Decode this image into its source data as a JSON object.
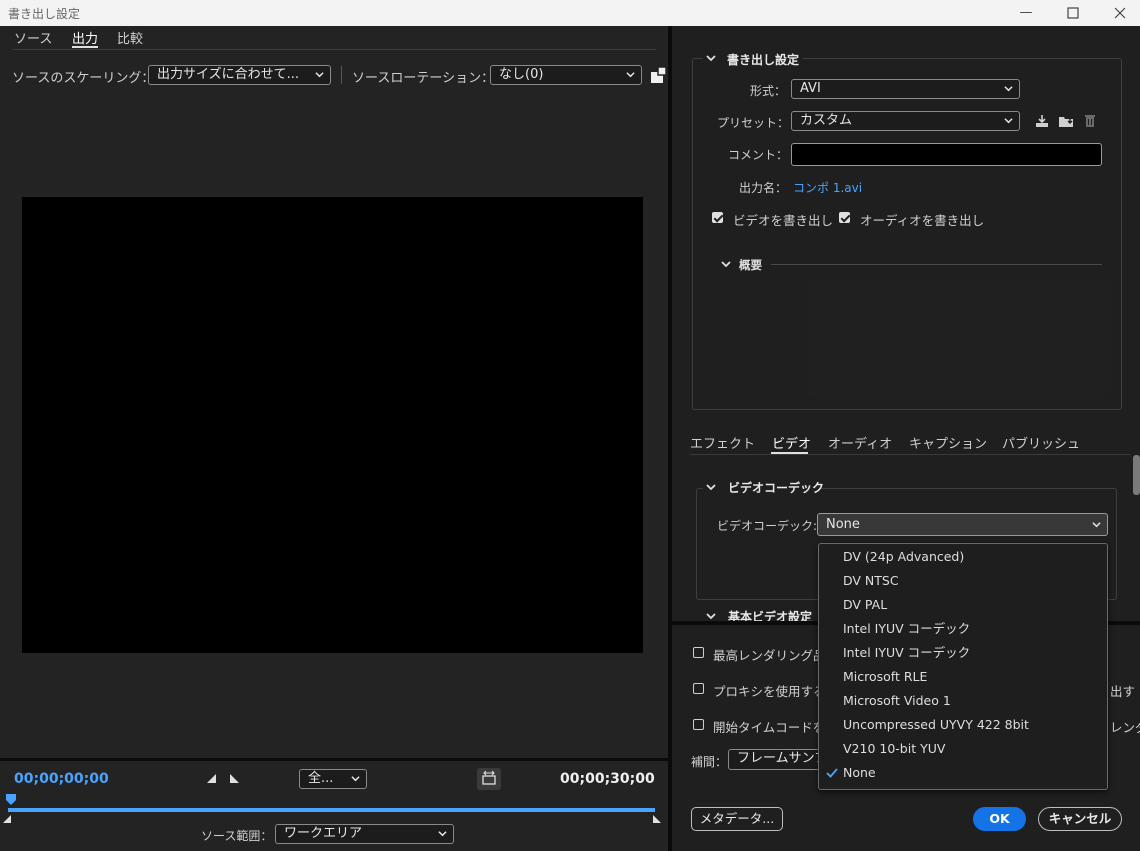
{
  "window": {
    "title": "書き出し設定"
  },
  "left": {
    "tabs": [
      "ソース",
      "出力",
      "比較"
    ],
    "scaling_label": "ソースのスケーリング：",
    "scaling_value": "出力サイズに合わせて...",
    "rotation_label": "ソースローテーション：",
    "rotation_value": "なし(0)",
    "timecode_start": "00;00;00;00",
    "timecode_end": "00;00;30;00",
    "zoom_value": "全...",
    "range_label": "ソース範囲：",
    "range_value": "ワークエリア"
  },
  "right": {
    "export": {
      "header": "書き出し設定",
      "format_label": "形式：",
      "format_value": "AVI",
      "preset_label": "プリセット：",
      "preset_value": "カスタム",
      "comment_label": "コメント：",
      "comment_value": "",
      "output_label": "出力名：",
      "output_value": "コンポ 1.avi",
      "video_export": "ビデオを書き出し",
      "audio_export": "オーディオを書き出し",
      "summary": "概要"
    },
    "tabs": [
      "エフェクト",
      "ビデオ",
      "オーディオ",
      "キャプション",
      "パブリッシュ"
    ],
    "codec_header": "ビデオコーデック",
    "codec_label": "ビデオコーデック:",
    "codec_value": "None",
    "basic_header": "基本ビデオ設定",
    "max_render": "最高レンダリング品",
    "use_proxy": "プロキシを使用する",
    "proxy_tail": "出す",
    "start_timecode": "開始タイムコードを",
    "start_tail": "レンダリン",
    "interp_label": "補間：",
    "interp_value": "フレームサンプ",
    "metadata_button": "メタデータ...",
    "ok_button": "OK",
    "cancel_button": "キャンセル"
  },
  "codec_menu": {
    "items": [
      "DV (24p Advanced)",
      "DV NTSC",
      "DV PAL",
      "Intel IYUV コーデック",
      "Intel IYUV コーデック",
      "Microsoft RLE",
      "Microsoft Video 1",
      "Uncompressed UYVY 422 8bit",
      "V210 10-bit YUV",
      "None"
    ],
    "selected": "None"
  },
  "colors": {
    "accent": "#1473e6",
    "link": "#4aa3ff",
    "timecode": "#4aa3ff"
  }
}
